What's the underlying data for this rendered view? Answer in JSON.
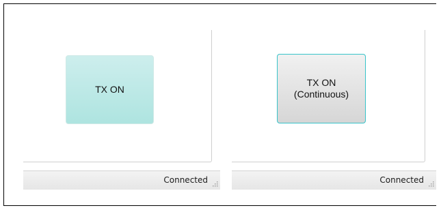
{
  "panes": [
    {
      "button": {
        "label": "TX ON"
      },
      "status": {
        "text": "Connected"
      }
    },
    {
      "button": {
        "label": "TX ON\n(Continuous)"
      },
      "status": {
        "text": "Connected"
      }
    }
  ],
  "colors": {
    "button_on_gradient_top": "#cdeeed",
    "button_on_gradient_bottom": "#aee4e0",
    "button_off_gradient_top": "#f1f1f1",
    "button_off_gradient_bottom": "#d6d6d6",
    "focus_border": "#36c3c9",
    "statusbar_bg": "#e9e9e9"
  },
  "icons": {
    "resize_grip": "resize-grip-icon"
  }
}
